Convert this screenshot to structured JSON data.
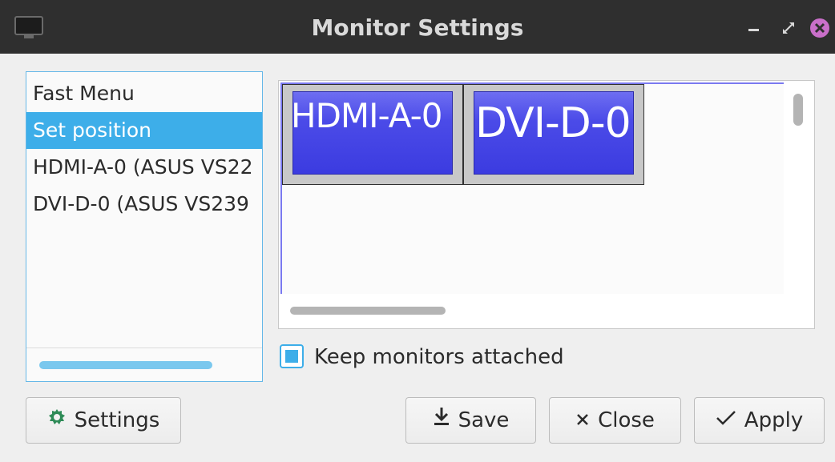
{
  "window": {
    "title": "Monitor Settings",
    "icons": {
      "app": "monitor-icon",
      "minimize": "minimize-icon",
      "maximize": "maximize-icon",
      "close": "close-icon"
    },
    "close_color": "#c96fc9"
  },
  "sidebar": {
    "items": [
      {
        "label": "Fast Menu",
        "selected": false
      },
      {
        "label": "Set position",
        "selected": true
      },
      {
        "label": "HDMI-A-0 (ASUS VS22",
        "selected": false
      },
      {
        "label": "DVI-D-0 (ASUS VS239",
        "selected": false
      }
    ],
    "accent": "#3daee9"
  },
  "preview": {
    "monitors": [
      {
        "name": "HDMI-A-0"
      },
      {
        "name": "DVI-D-0"
      }
    ],
    "screen_color": "#4b4be8"
  },
  "options": {
    "keep_attached_label": "Keep monitors attached",
    "keep_attached_checked": true
  },
  "buttons": {
    "settings": {
      "label": "Settings",
      "icon": "gear-icon"
    },
    "save": {
      "label": "Save",
      "icon": "download-icon"
    },
    "close": {
      "label": "Close",
      "icon": "x-icon"
    },
    "apply": {
      "label": "Apply",
      "icon": "checkmark-icon"
    }
  }
}
